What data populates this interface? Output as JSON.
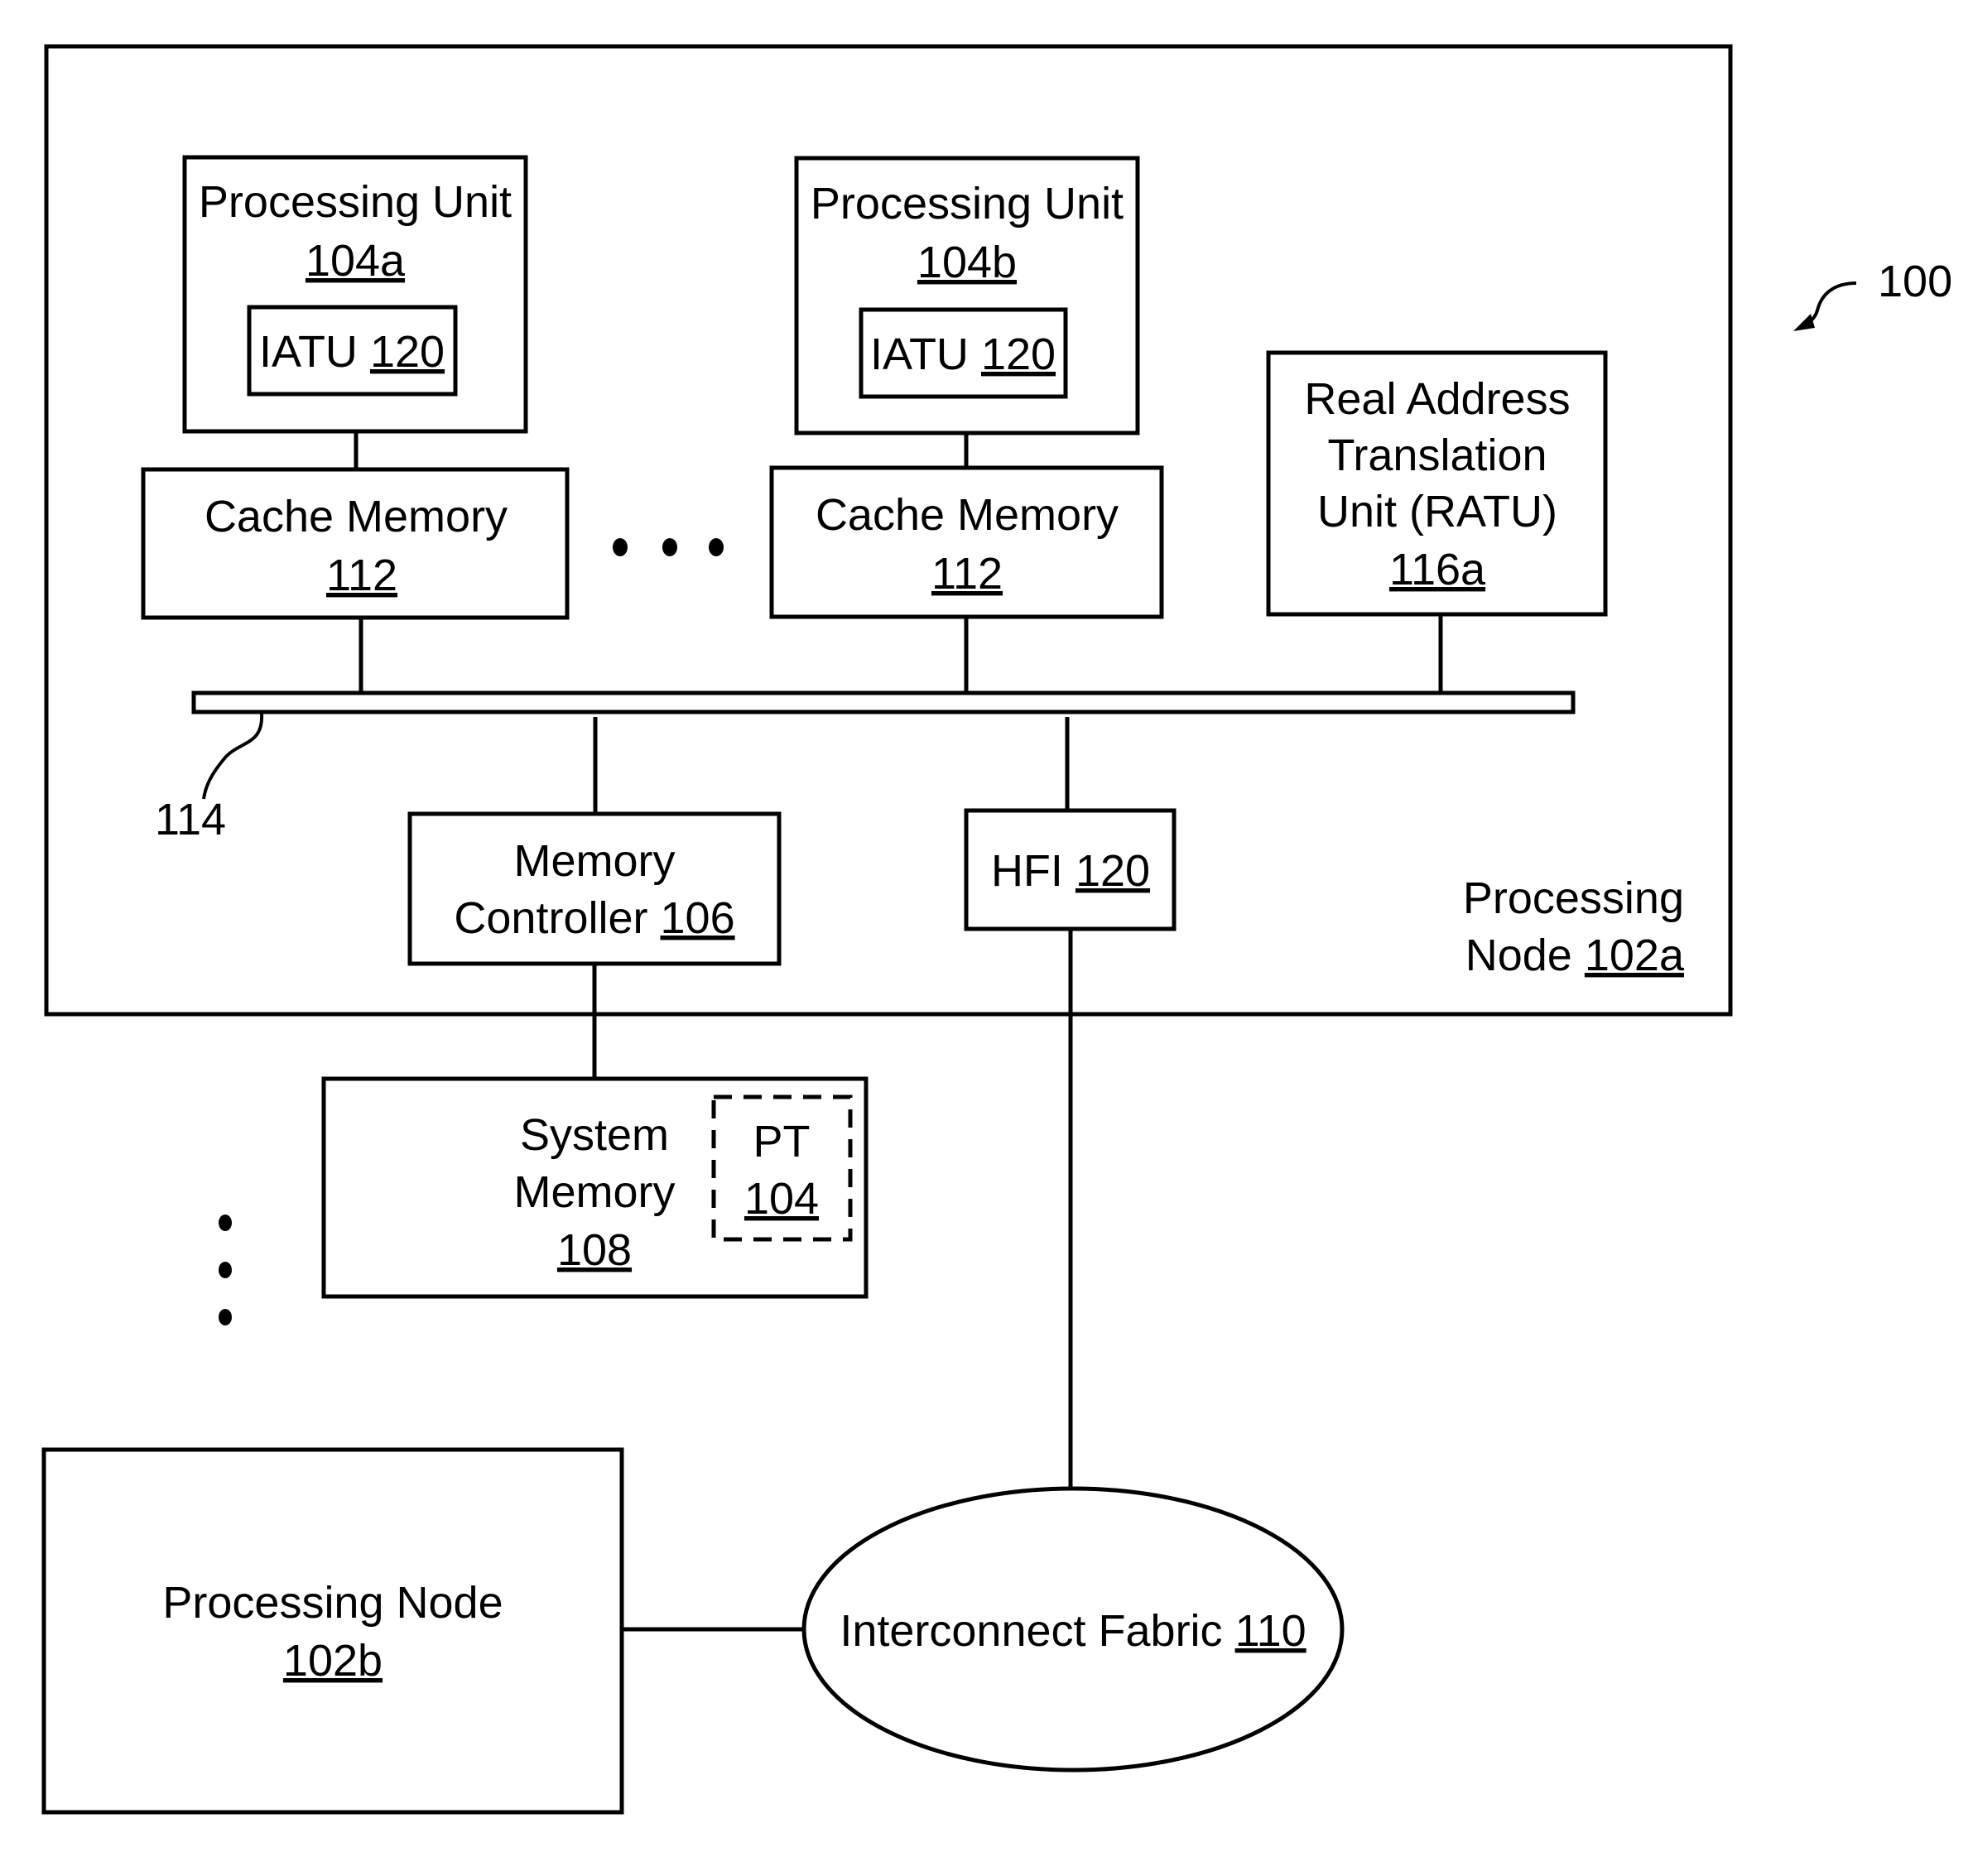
{
  "figure": {
    "ref_label": "100",
    "bus_label": "114"
  },
  "processing_node_a": {
    "title_line1": "Processing",
    "title_line2": "Node",
    "ref": "102a"
  },
  "processing_units": [
    {
      "title": "Processing Unit",
      "ref": "104a",
      "iatu_label": "IATU",
      "iatu_ref": "120"
    },
    {
      "title": "Processing Unit",
      "ref": "104b",
      "iatu_label": "IATU",
      "iatu_ref": "120"
    }
  ],
  "cache_memories": [
    {
      "title": "Cache Memory",
      "ref": "112"
    },
    {
      "title": "Cache Memory",
      "ref": "112"
    }
  ],
  "ratu": {
    "line1": "Real Address",
    "line2": "Translation",
    "line3": "Unit (RATU)",
    "ref": "116a"
  },
  "memory_controller": {
    "line1": "Memory",
    "line2": "Controller",
    "ref": "106"
  },
  "hfi": {
    "label": "HFI",
    "ref": "120"
  },
  "system_memory": {
    "line1": "System",
    "line2": "Memory",
    "ref": "108",
    "pt_label": "PT",
    "pt_ref": "104"
  },
  "processing_node_b": {
    "title": "Processing Node",
    "ref": "102b"
  },
  "interconnect": {
    "label": "Interconnect Fabric",
    "ref": "110"
  }
}
